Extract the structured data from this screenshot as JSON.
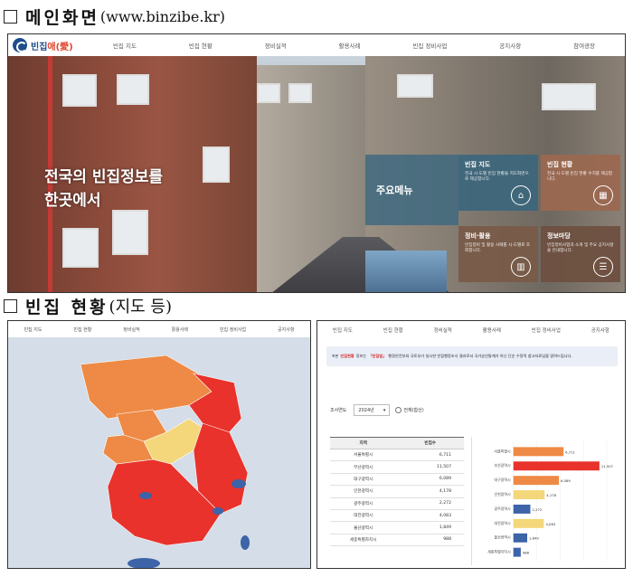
{
  "section1": {
    "title": "메인화면",
    "url": "(www.binzibe.kr)"
  },
  "home": {
    "logo_text": "빈집",
    "logo_accent": "애(愛)",
    "nav": [
      "빈집 지도",
      "빈집 현황",
      "정비실적",
      "활용사례",
      "빈집 정비사업",
      "공지사항",
      "참여광장"
    ],
    "hero_line1": "전국의 빈집정보를",
    "hero_line2": "한곳에서",
    "main_menu_label": "주요메뉴",
    "cards": [
      {
        "title": "빈집 지도",
        "desc": "전국 시·도별 빈집 현황을 지도화면으로 제공합니다.",
        "icon": "house-icon"
      },
      {
        "title": "빈집 현황",
        "desc": "전국 시·도별 빈집 현황 수치를 제공합니다.",
        "icon": "calculator-icon"
      },
      {
        "title": "정비·활용",
        "desc": "빈집정비 및 활용 사례를 시·도별로 조회합니다.",
        "icon": "chart-icon"
      },
      {
        "title": "정보마당",
        "desc": "빈집정비사업과 소개 및 주요 공지사항을 안내합니다.",
        "icon": "document-icon"
      }
    ],
    "colors": {
      "brand": "#1f4e8c",
      "accent": "#e0442a"
    }
  },
  "section2": {
    "title": "빈집 현황",
    "paren": "(지도 등)"
  },
  "map_shot": {
    "nav": [
      "빈집 지도",
      "빈집 현황",
      "정비실적",
      "활용사례",
      "빈집 정비사업",
      "공지사항"
    ],
    "colors": {
      "high": "#e8322b",
      "mid": "#ee8a45",
      "low": "#f4d77a",
      "blue": "#3d63a8",
      "sea": "#d4dde8"
    }
  },
  "table_shot": {
    "nav": [
      "빈집 지도",
      "빈집 현황",
      "정비실적",
      "활용사례",
      "빈집 정비사업",
      "공지사항"
    ],
    "notice_pre": "※본",
    "notice_red": "빈집현황",
    "notice_mid": "정보는",
    "notice_red2": "「빈집법」",
    "notice_post": "행정안전부와 국토부가 실시한 빈집행정조사 결과로서 국가승인통계가 아닌 단순 수량적 참고자료임을 알려드립니다.",
    "filter_label": "조사연도",
    "year_value": "2024년",
    "radio_label": "전체(합산)",
    "col_region": "지역",
    "col_count": "빈집수",
    "rows": [
      {
        "region": "서울특별시",
        "count": "6,711"
      },
      {
        "region": "부산광역시",
        "count": "11,507"
      },
      {
        "region": "대구광역시",
        "count": "6,089"
      },
      {
        "region": "인천광역시",
        "count": "4,178"
      },
      {
        "region": "광주광역시",
        "count": "2,272"
      },
      {
        "region": "대전광역시",
        "count": "4,083"
      },
      {
        "region": "울산광역시",
        "count": "1,849"
      },
      {
        "region": "세종특별자치시",
        "count": "988"
      }
    ]
  },
  "chart_data": {
    "type": "bar",
    "orientation": "horizontal",
    "categories": [
      "서울특별시",
      "부산광역시",
      "대구광역시",
      "인천광역시",
      "광주광역시",
      "대전광역시",
      "울산광역시",
      "세종특별자치시"
    ],
    "values": [
      6711,
      11507,
      6089,
      4178,
      2272,
      4083,
      1849,
      988
    ],
    "value_labels": [
      "6,711",
      "11,507",
      "6,089",
      "4,178",
      "2,272",
      "4,083",
      "1,849",
      "988"
    ],
    "colors": [
      "#ee8a45",
      "#e8322b",
      "#ee8a45",
      "#f4d77a",
      "#3d63a8",
      "#f4d77a",
      "#3d63a8",
      "#3d63a8"
    ],
    "xlim": [
      0,
      12500
    ],
    "title": "",
    "xlabel": "",
    "ylabel": ""
  }
}
